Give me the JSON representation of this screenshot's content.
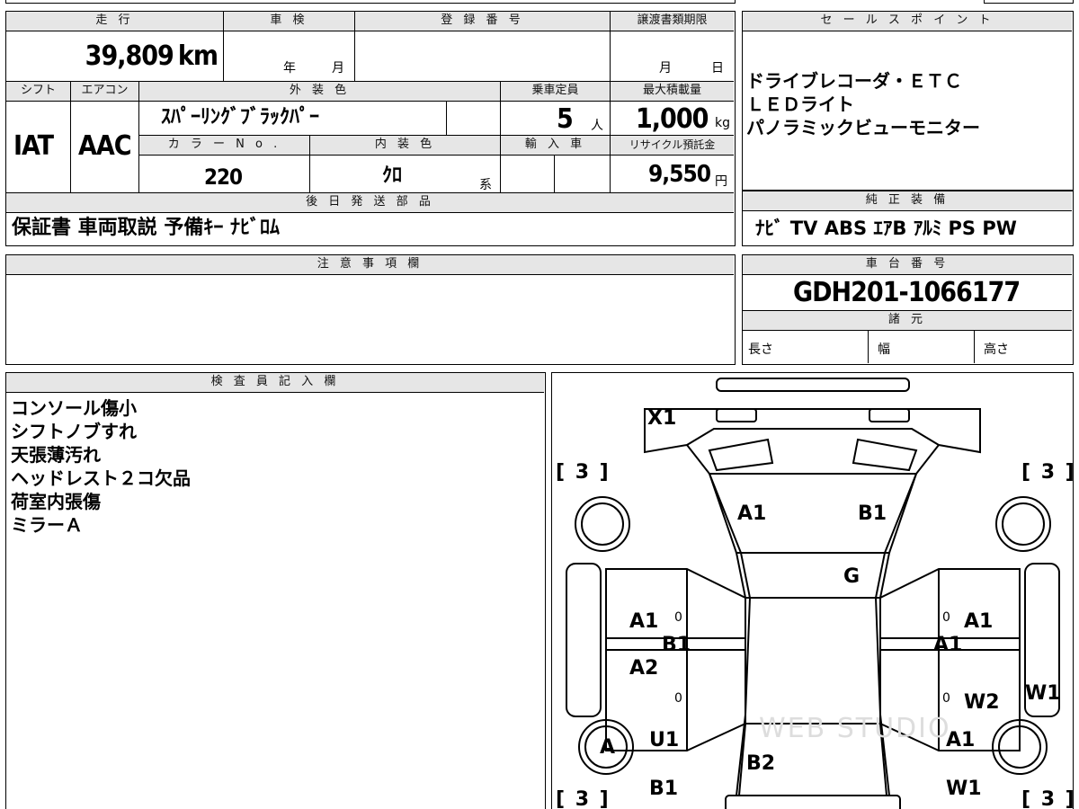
{
  "headers": {
    "mileage": "走 行",
    "inspection": "車 検",
    "registration": "登 録 番 号",
    "transfer_deadline": "譲渡書類期限",
    "sales_point": "セ ー ル ス ポ イ ン ト",
    "shift": "シフト",
    "aircon": "エアコン",
    "exterior_color": "外 装 色",
    "capacity": "乗車定員",
    "max_load": "最大積載量",
    "color_no": "カ ラ ー N o .",
    "interior_color": "内 装 色",
    "import": "輸 入 車",
    "recycle": "リサイクル預託金",
    "later_parts": "後 日 発 送 部 品",
    "genuine": "純 正 装 備",
    "notes": "注 意 事 項 欄",
    "chassis": "車 台 番 号",
    "specs": "諸 元",
    "inspector": "検 査 員 記 入 欄"
  },
  "vehicle": {
    "mileage_value": "39,809",
    "mileage_unit": "km",
    "year_unit": "年",
    "month_unit": "月",
    "deadline_month": "月",
    "deadline_day": "日",
    "shift_value": "IAT",
    "aircon_value": "AAC",
    "exterior_color_value": "ｽﾊﾟｰﾘﾝｸﾞﾌﾞﾗｯｸﾊﾟｰ",
    "capacity_value": "5",
    "capacity_unit": "人",
    "max_load_value": "1,000",
    "max_load_unit": "kg",
    "color_no_value": "220",
    "interior_color_value": "ｸﾛ",
    "interior_color_suffix": "系",
    "recycle_value": "9,550",
    "recycle_unit": "円",
    "chassis_value": "GDH201-1066177",
    "spec_length": "長さ",
    "spec_width": "幅",
    "spec_height": "高さ"
  },
  "sales_points": [
    "ドライブレコーダ・ＥＴＣ",
    "ＬＥＤライト",
    "パノラミックビューモニター"
  ],
  "later_parts_value": "保証書 車両取説 予備ｷｰ ﾅﾋﾞﾛﾑ",
  "genuine_value": "ﾅﾋﾞ TV ABS ｴｱB ｱﾙﾐ PS PW",
  "inspector_notes": [
    "コンソール傷小",
    "シフトノブすれ",
    "天張薄汚れ",
    "ヘッドレスト２コ欠品",
    "荷室内張傷",
    "ミラーＡ"
  ],
  "diagram": {
    "x1": "X1",
    "bracket_tl": "[ 3 ]",
    "bracket_tr": "[ 3 ]",
    "bracket_bl": "[ 3 ]",
    "bracket_br": "[ 3 ]",
    "hood_left": "A1",
    "hood_right": "B1",
    "windshield": "G",
    "left_front_door_a": "A1",
    "left_front_door_b": "B1",
    "left_rear_door": "A2",
    "right_front_door_a": "A1",
    "right_front_door_b": "A1",
    "right_rear_door": "W2",
    "right_side": "W1",
    "left_wheel": "A",
    "left_rear_u": "U1",
    "left_rear_b": "B1",
    "rear_center": "B2",
    "right_rear_a": "A1",
    "right_rear_w": "W1",
    "pillar_mark_1": "0",
    "pillar_mark_2": "0",
    "pillar_mark_3": "0",
    "pillar_mark_4": "0",
    "watermark": "WEB STUDIO"
  }
}
